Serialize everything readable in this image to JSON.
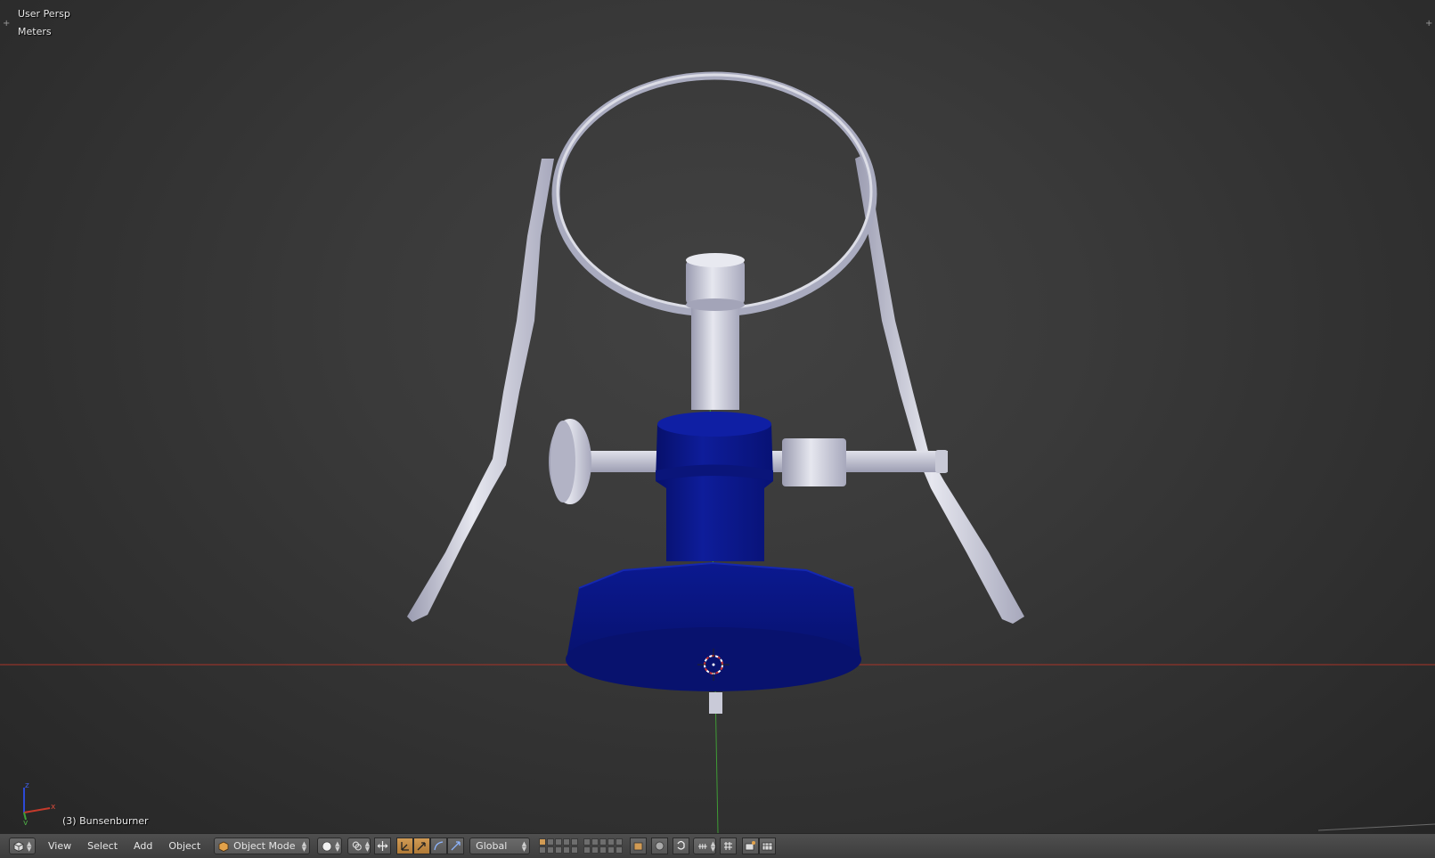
{
  "viewport": {
    "view_name": "User Persp",
    "units": "Meters",
    "active_object": "(3) Bunsenburner"
  },
  "header": {
    "menus": [
      "View",
      "Select",
      "Add",
      "Object"
    ],
    "mode": "Object Mode",
    "orientation": "Global"
  },
  "axes": {
    "x": "x",
    "y": "y",
    "z": "z"
  },
  "icons": {
    "editor_type": "3d-view-cube-icon",
    "shading": "solid-sphere-icon",
    "pivot": "pivot-icon",
    "manipulator": "manipulator-icon",
    "translate": "translate-arrow-icon",
    "rotate": "rotate-arc-icon",
    "scale": "scale-icon",
    "layers": "layers-grid-icon",
    "lock": "lock-camera-icon",
    "proportional": "proportional-edit-icon",
    "snap": "snap-magnet-icon",
    "snap_target": "snap-target-icon",
    "render": "render-icon",
    "render_anim": "render-animation-icon"
  },
  "colors": {
    "viewport_bg": "#3a3a3a",
    "x_axis": "#b83a2e",
    "y_axis": "#3f9c35",
    "object_blue": "#0d1a8a",
    "metal": "#c4c6d6",
    "accent": "#d19b54"
  }
}
